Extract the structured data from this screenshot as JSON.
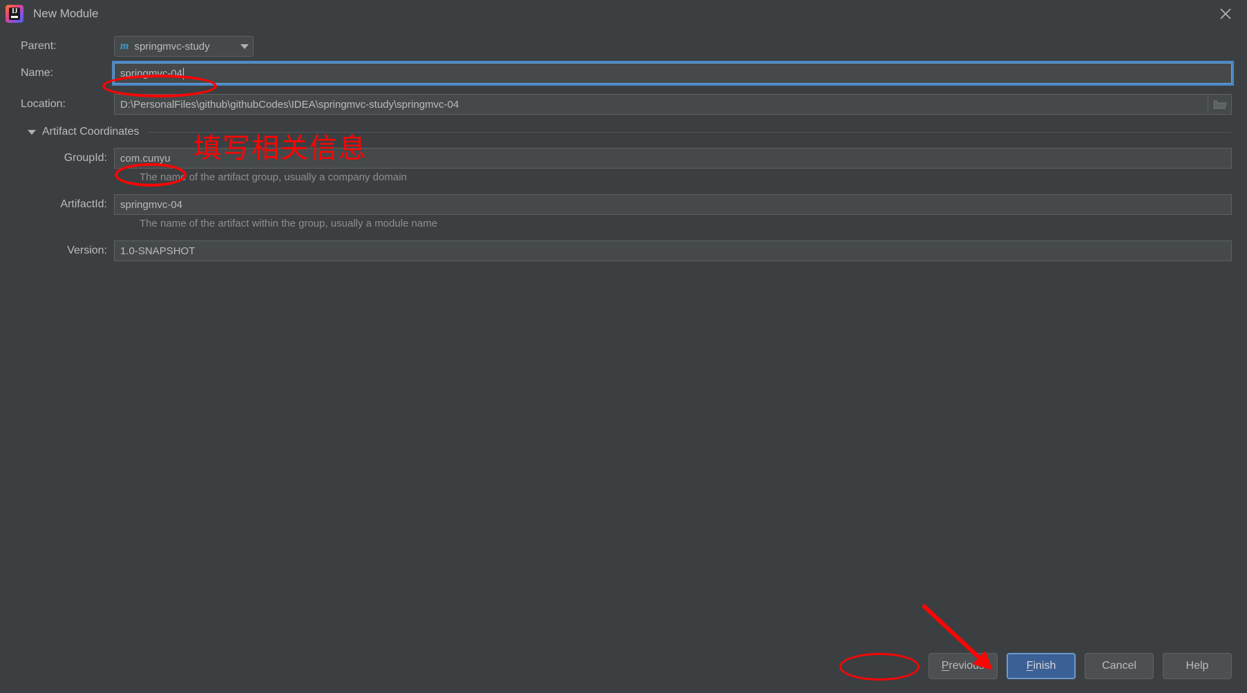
{
  "window": {
    "title": "New Module",
    "app_icon": "intellij-idea-icon",
    "close_icon": "close-icon"
  },
  "form": {
    "parent": {
      "label": "Parent:",
      "value": "springmvc-study",
      "icon": "maven-module-icon",
      "dropdown_icon": "chevron-down-icon"
    },
    "name": {
      "label": "Name:",
      "value": "springmvc-04",
      "focused": true
    },
    "location": {
      "label": "Location:",
      "value": "D:\\PersonalFiles\\github\\githubCodes\\IDEA\\springmvc-study\\springmvc-04",
      "browse_icon": "folder-icon"
    },
    "artifact_coordinates": {
      "section_title": "Artifact Coordinates",
      "collapse_icon": "triangle-down-icon",
      "group_id": {
        "label": "GroupId:",
        "value": "com.cunyu",
        "hint": "The name of the artifact group, usually a company domain"
      },
      "artifact_id": {
        "label": "ArtifactId:",
        "value": "springmvc-04",
        "hint": "The name of the artifact within the group, usually a module name"
      },
      "version": {
        "label": "Version:",
        "value": "1.0-SNAPSHOT"
      }
    }
  },
  "footer": {
    "previous": "Previous",
    "previous_mnemonic": "P",
    "finish": "Finish",
    "finish_mnemonic": "F",
    "cancel": "Cancel",
    "help": "Help"
  },
  "annotations": {
    "note_cn": "填写相关信息",
    "color": "#fb0505",
    "arrow_icon": "red-arrow-icon",
    "circled": [
      "name-field-value",
      "group-id-field-value",
      "finish-button"
    ]
  }
}
